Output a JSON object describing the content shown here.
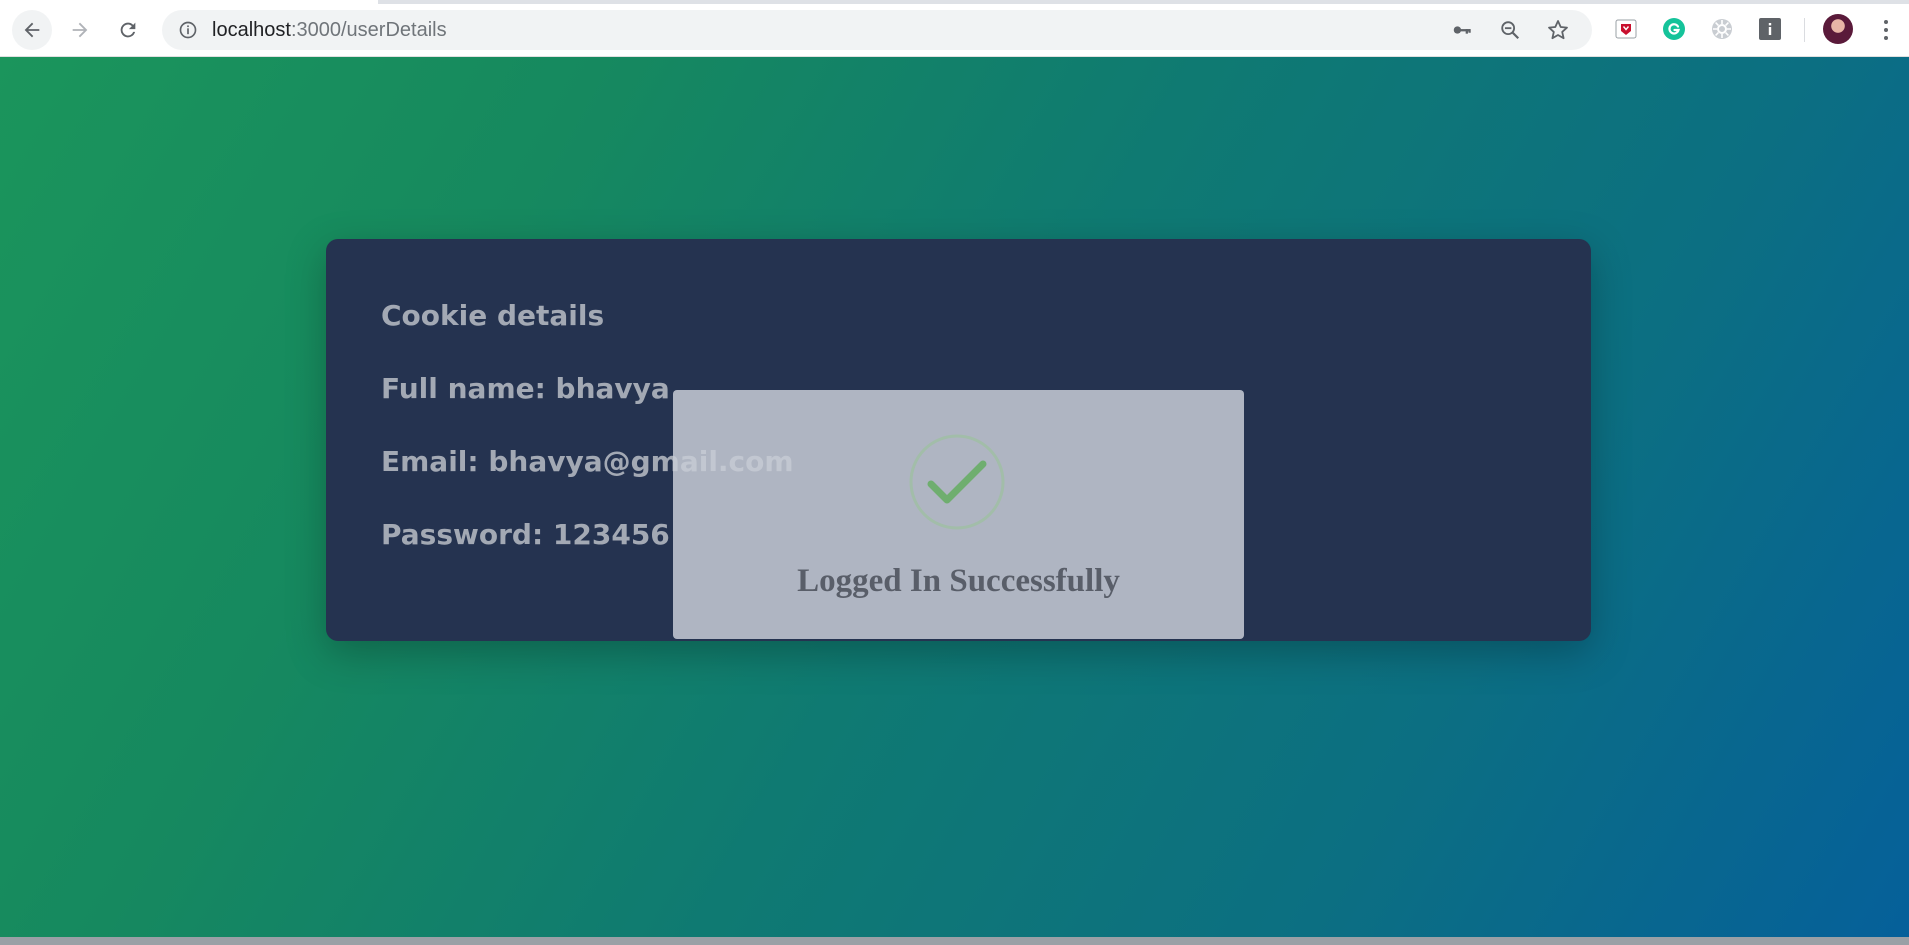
{
  "browser": {
    "url_host": "localhost",
    "url_path": ":3000/userDetails",
    "icons": {
      "back": "arrow-left-icon",
      "forward": "arrow-right-icon",
      "reload": "reload-icon",
      "site_info": "info-icon",
      "password_key": "key-icon",
      "zoom": "zoom-out-icon",
      "bookmark": "star-icon",
      "extension_1": "mcafee-icon",
      "extension_2": "grammarly-icon",
      "extension_3": "extension-gear-icon",
      "extension_4": "info-extension-icon",
      "profile": "avatar-icon",
      "menu": "kebab-menu-icon"
    }
  },
  "card": {
    "title": "Cookie details",
    "full_name": "Full name: bhavya",
    "email": "Email: bhavya@gmail.com",
    "password": "Password: 123456"
  },
  "modal": {
    "message": "Logged In Successfully",
    "icon": "checkmark-icon"
  },
  "colors": {
    "page_gradient_start": "#1b955c",
    "page_gradient_end": "#05609a",
    "card_background": "#253350",
    "card_text": "#a3a9b4",
    "modal_background": "#c8cdd6",
    "success_green": "#6fae6f"
  }
}
